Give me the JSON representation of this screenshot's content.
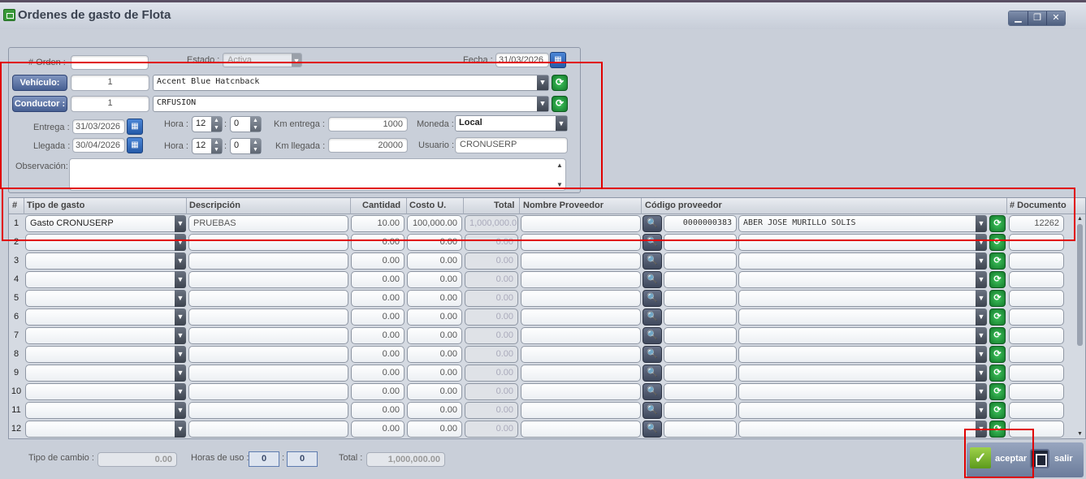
{
  "window": {
    "title": "Ordenes de gasto de Flota",
    "buttons": {
      "minimize": "▁",
      "maximize": "❐",
      "close": "✕"
    }
  },
  "form": {
    "orden_label": "# Orden :",
    "orden_value": "",
    "estado_label": "Estado :",
    "estado_value": "Activa",
    "fecha_label": "Fecha :",
    "fecha_value": "31/03/2026",
    "vehiculo_button": "Vehículo:",
    "vehiculo_id": "1",
    "vehiculo_name": "Accent Blue Hatcnback",
    "conductor_button": "Conductor :",
    "conductor_id": "1",
    "conductor_name": "CRFUSION",
    "entrega_label": "Entrega :",
    "entrega_date": "31/03/2026",
    "llegada_label": "Llegada :",
    "llegada_date": "30/04/2026",
    "hora_label": "Hora :",
    "entrega_hour": "12",
    "entrega_min": "0",
    "llegada_hour": "12",
    "llegada_min": "0",
    "km_entrega_label": "Km entrega :",
    "km_entrega_value": "1000",
    "km_llegada_label": "Km llegada :",
    "km_llegada_value": "20000",
    "moneda_label": "Moneda :",
    "moneda_value": "Local",
    "usuario_label": "Usuario :",
    "usuario_value": "CRONUSERP",
    "observacion_label": "Observación:",
    "colon": ":"
  },
  "grid": {
    "headers": {
      "num": "#",
      "tipo": "Tipo de gasto",
      "descripcion": "Descripción",
      "cantidad": "Cantidad",
      "costo": "Costo U.",
      "total": "Total",
      "nombre_proveedor": "Nombre Proveedor",
      "codigo_proveedor": "Código proveedor",
      "documento": "# Documento"
    },
    "rows": [
      {
        "num": "1",
        "tipo": "Gasto CRONUSERP",
        "descripcion": "PRUEBAS",
        "cantidad": "10.00",
        "costo": "100,000.00",
        "total": "1,000,000.0",
        "nombre": "",
        "codigo": "0000000383",
        "proveedor": "ABER JOSE MURILLO SOLIS",
        "documento": "12262"
      },
      {
        "num": "2",
        "tipo": "",
        "descripcion": "",
        "cantidad": "0.00",
        "costo": "0.00",
        "total": "0.00",
        "nombre": "",
        "codigo": "",
        "proveedor": "",
        "documento": ""
      },
      {
        "num": "3",
        "tipo": "",
        "descripcion": "",
        "cantidad": "0.00",
        "costo": "0.00",
        "total": "0.00",
        "nombre": "",
        "codigo": "",
        "proveedor": "",
        "documento": ""
      },
      {
        "num": "4",
        "tipo": "",
        "descripcion": "",
        "cantidad": "0.00",
        "costo": "0.00",
        "total": "0.00",
        "nombre": "",
        "codigo": "",
        "proveedor": "",
        "documento": ""
      },
      {
        "num": "5",
        "tipo": "",
        "descripcion": "",
        "cantidad": "0.00",
        "costo": "0.00",
        "total": "0.00",
        "nombre": "",
        "codigo": "",
        "proveedor": "",
        "documento": ""
      },
      {
        "num": "6",
        "tipo": "",
        "descripcion": "",
        "cantidad": "0.00",
        "costo": "0.00",
        "total": "0.00",
        "nombre": "",
        "codigo": "",
        "proveedor": "",
        "documento": ""
      },
      {
        "num": "7",
        "tipo": "",
        "descripcion": "",
        "cantidad": "0.00",
        "costo": "0.00",
        "total": "0.00",
        "nombre": "",
        "codigo": "",
        "proveedor": "",
        "documento": ""
      },
      {
        "num": "8",
        "tipo": "",
        "descripcion": "",
        "cantidad": "0.00",
        "costo": "0.00",
        "total": "0.00",
        "nombre": "",
        "codigo": "",
        "proveedor": "",
        "documento": ""
      },
      {
        "num": "9",
        "tipo": "",
        "descripcion": "",
        "cantidad": "0.00",
        "costo": "0.00",
        "total": "0.00",
        "nombre": "",
        "codigo": "",
        "proveedor": "",
        "documento": ""
      },
      {
        "num": "10",
        "tipo": "",
        "descripcion": "",
        "cantidad": "0.00",
        "costo": "0.00",
        "total": "0.00",
        "nombre": "",
        "codigo": "",
        "proveedor": "",
        "documento": ""
      },
      {
        "num": "11",
        "tipo": "",
        "descripcion": "",
        "cantidad": "0.00",
        "costo": "0.00",
        "total": "0.00",
        "nombre": "",
        "codigo": "",
        "proveedor": "",
        "documento": ""
      },
      {
        "num": "12",
        "tipo": "",
        "descripcion": "",
        "cantidad": "0.00",
        "costo": "0.00",
        "total": "0.00",
        "nombre": "",
        "codigo": "",
        "proveedor": "",
        "documento": ""
      }
    ]
  },
  "footer": {
    "tipo_cambio_label": "Tipo de cambio :",
    "tipo_cambio_value": "0.00",
    "horas_uso_label": "Horas de uso :",
    "horas_uso_a": "0",
    "horas_uso_b": "0",
    "colon": ":",
    "total_label": "Total :",
    "total_value": "1,000,000.00"
  },
  "actions": {
    "accept_label": "aceptar",
    "exit_label": "salir"
  },
  "icons": {
    "dropdown": "▼",
    "search": "🔍",
    "refresh": "⟳",
    "calendar": "▦",
    "spin_up": "▲",
    "spin_down": "▼",
    "check": "✓"
  },
  "colors": {
    "highlight": "#e00000",
    "accept": "#7ab83a",
    "primary_button": "#465f92"
  }
}
